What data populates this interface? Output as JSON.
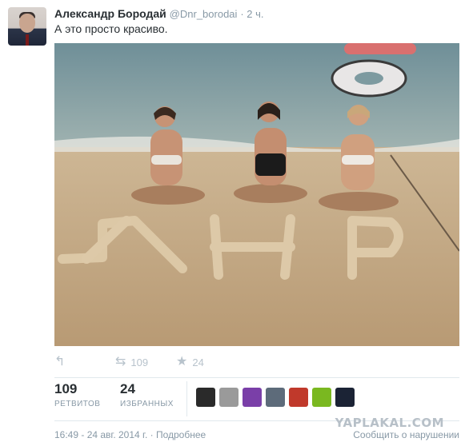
{
  "tweet": {
    "author_name": "Александр Бородай",
    "handle": "@Dnr_borodai",
    "time": "· 2 ч.",
    "text": "А это просто красиво.",
    "sand_text": "ДНР"
  },
  "actions": {
    "reply_icon": "reply-icon",
    "retweet_icon": "retweet-icon",
    "retweet_count": "109",
    "favorite_icon": "star-icon",
    "favorite_count": "24"
  },
  "stats": {
    "retweets_num": "109",
    "retweets_label": "РЕТВИТОВ",
    "favorites_num": "24",
    "favorites_label": "ИЗБРАННЫХ",
    "favoriter_avatar_colors": [
      "#2a2a2a",
      "#9a9a9a",
      "#7a3fa8",
      "#5d6b7a",
      "#c0392b",
      "#7ab820",
      "#1b2335"
    ]
  },
  "footer": {
    "timestamp": "16:49 - 24 авг. 2014 г.",
    "details_link": "· Подробнее",
    "report_link": "Сообщить о нарушении"
  },
  "watermark": "YAPLAKAL.COM"
}
